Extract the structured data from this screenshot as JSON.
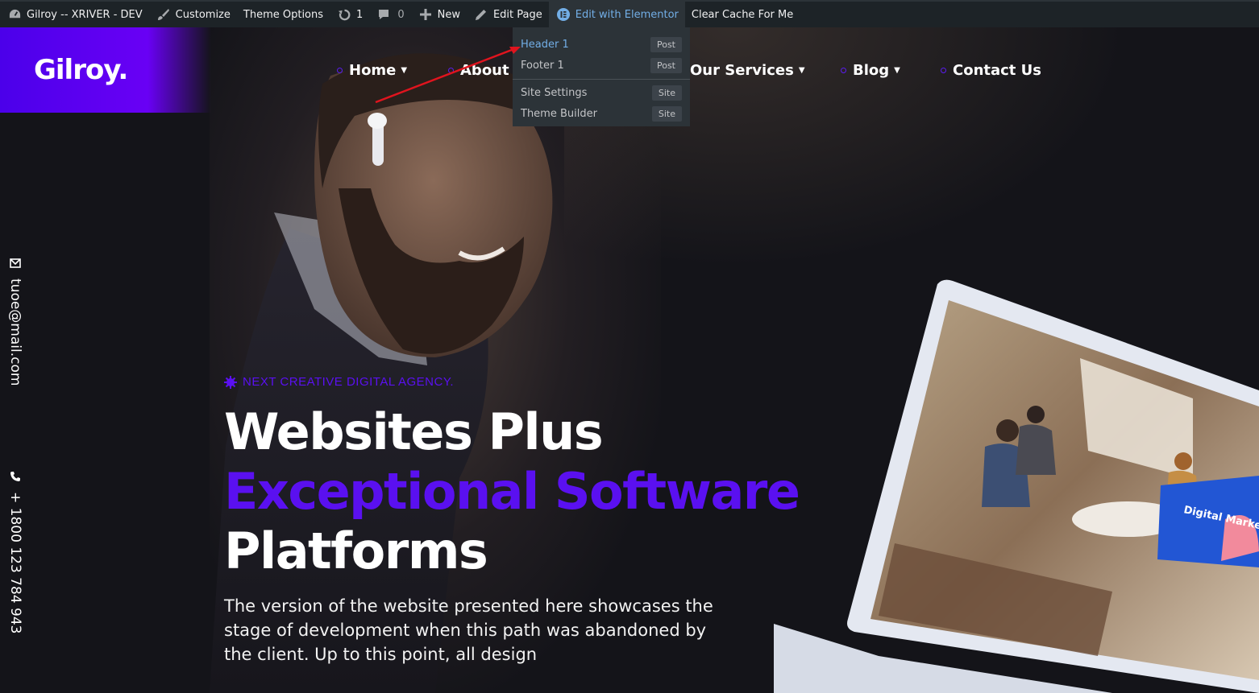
{
  "adminbar": {
    "site_name": "Gilroy -- XRIVER - DEV",
    "customize": "Customize",
    "theme_options": "Theme Options",
    "updates_count": "1",
    "comments_count": "0",
    "new_label": "New",
    "edit_page": "Edit Page",
    "edit_elementor": "Edit with Elementor",
    "clear_cache": "Clear Cache For Me",
    "icons": [
      "dashboard-icon",
      "brush-icon",
      "updates-icon",
      "comments-icon",
      "plus-icon",
      "pencil-icon",
      "elementor-icon"
    ]
  },
  "elementor_menu": {
    "items": [
      {
        "label": "Header 1",
        "tag": "Post"
      },
      {
        "label": "Footer 1",
        "tag": "Post"
      },
      {
        "label": "Site Settings",
        "tag": "Site"
      },
      {
        "label": "Theme Builder",
        "tag": "Site"
      }
    ]
  },
  "logo": "Gilroy.",
  "nav": {
    "home": "Home",
    "about": "About",
    "services": "Our Services",
    "blog": "Blog",
    "contact": "Contact Us"
  },
  "side": {
    "email": "tuoe@mail.com",
    "phone": "+ 1800 123 784 943"
  },
  "hero": {
    "eyebrow": "NEXT CREATIVE DIGITAL AGENCY.",
    "line1": "Websites Plus",
    "line2": "Exceptional Software",
    "line3": "Platforms",
    "lead": "The version of the website presented here showcases the stage of development when this path was abandoned by the client. Up to this point, all design"
  },
  "laptop_screen_text": "Digital Marketing",
  "colors": {
    "accent": "#5a10f0",
    "adminbar": "#1d2327",
    "link_blue": "#72aee6",
    "annotation": "#e0141e"
  }
}
